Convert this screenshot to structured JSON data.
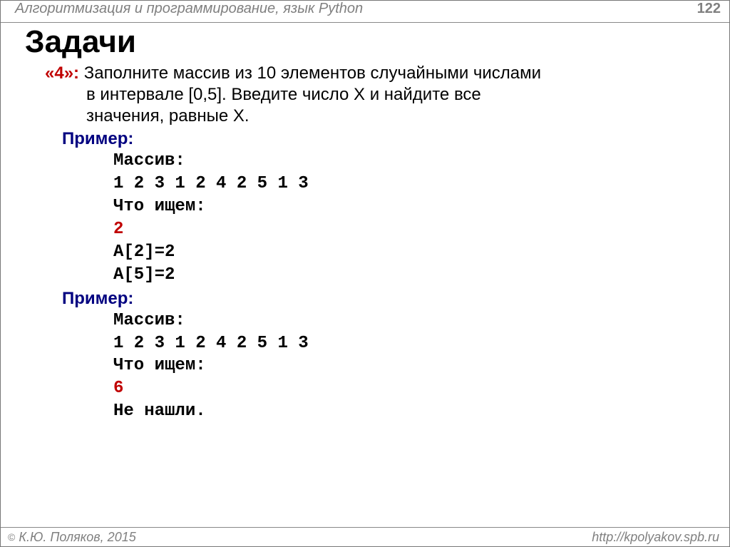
{
  "header": {
    "title": "Алгоритмизация и программирование, язык Python",
    "page": "122"
  },
  "main": {
    "title": "Задачи",
    "grade": "«4»:",
    "problem_l1": "Заполните массив из 10 элементов случайными числами",
    "problem_l2": "в интервале [0,5]. Введите число X и найдите все",
    "problem_l3": "значения, равные X.",
    "example_label": "Пример:",
    "ex1": {
      "array_label": "Массив:",
      "array_values": "1 2 3 1 2 4 2 5 1 3",
      "search_label": "Что ищем:",
      "search_value": "2",
      "result1": "A[2]=2",
      "result2": "A[5]=2"
    },
    "ex2": {
      "array_label": "Массив:",
      "array_values": "1 2 3 1 2 4 2 5 1 3",
      "search_label": "Что ищем:",
      "search_value": "6",
      "result": "Не нашли."
    }
  },
  "footer": {
    "copyright": " К.Ю. Поляков, 2015",
    "url": "http://kpolyakov.spb.ru"
  }
}
